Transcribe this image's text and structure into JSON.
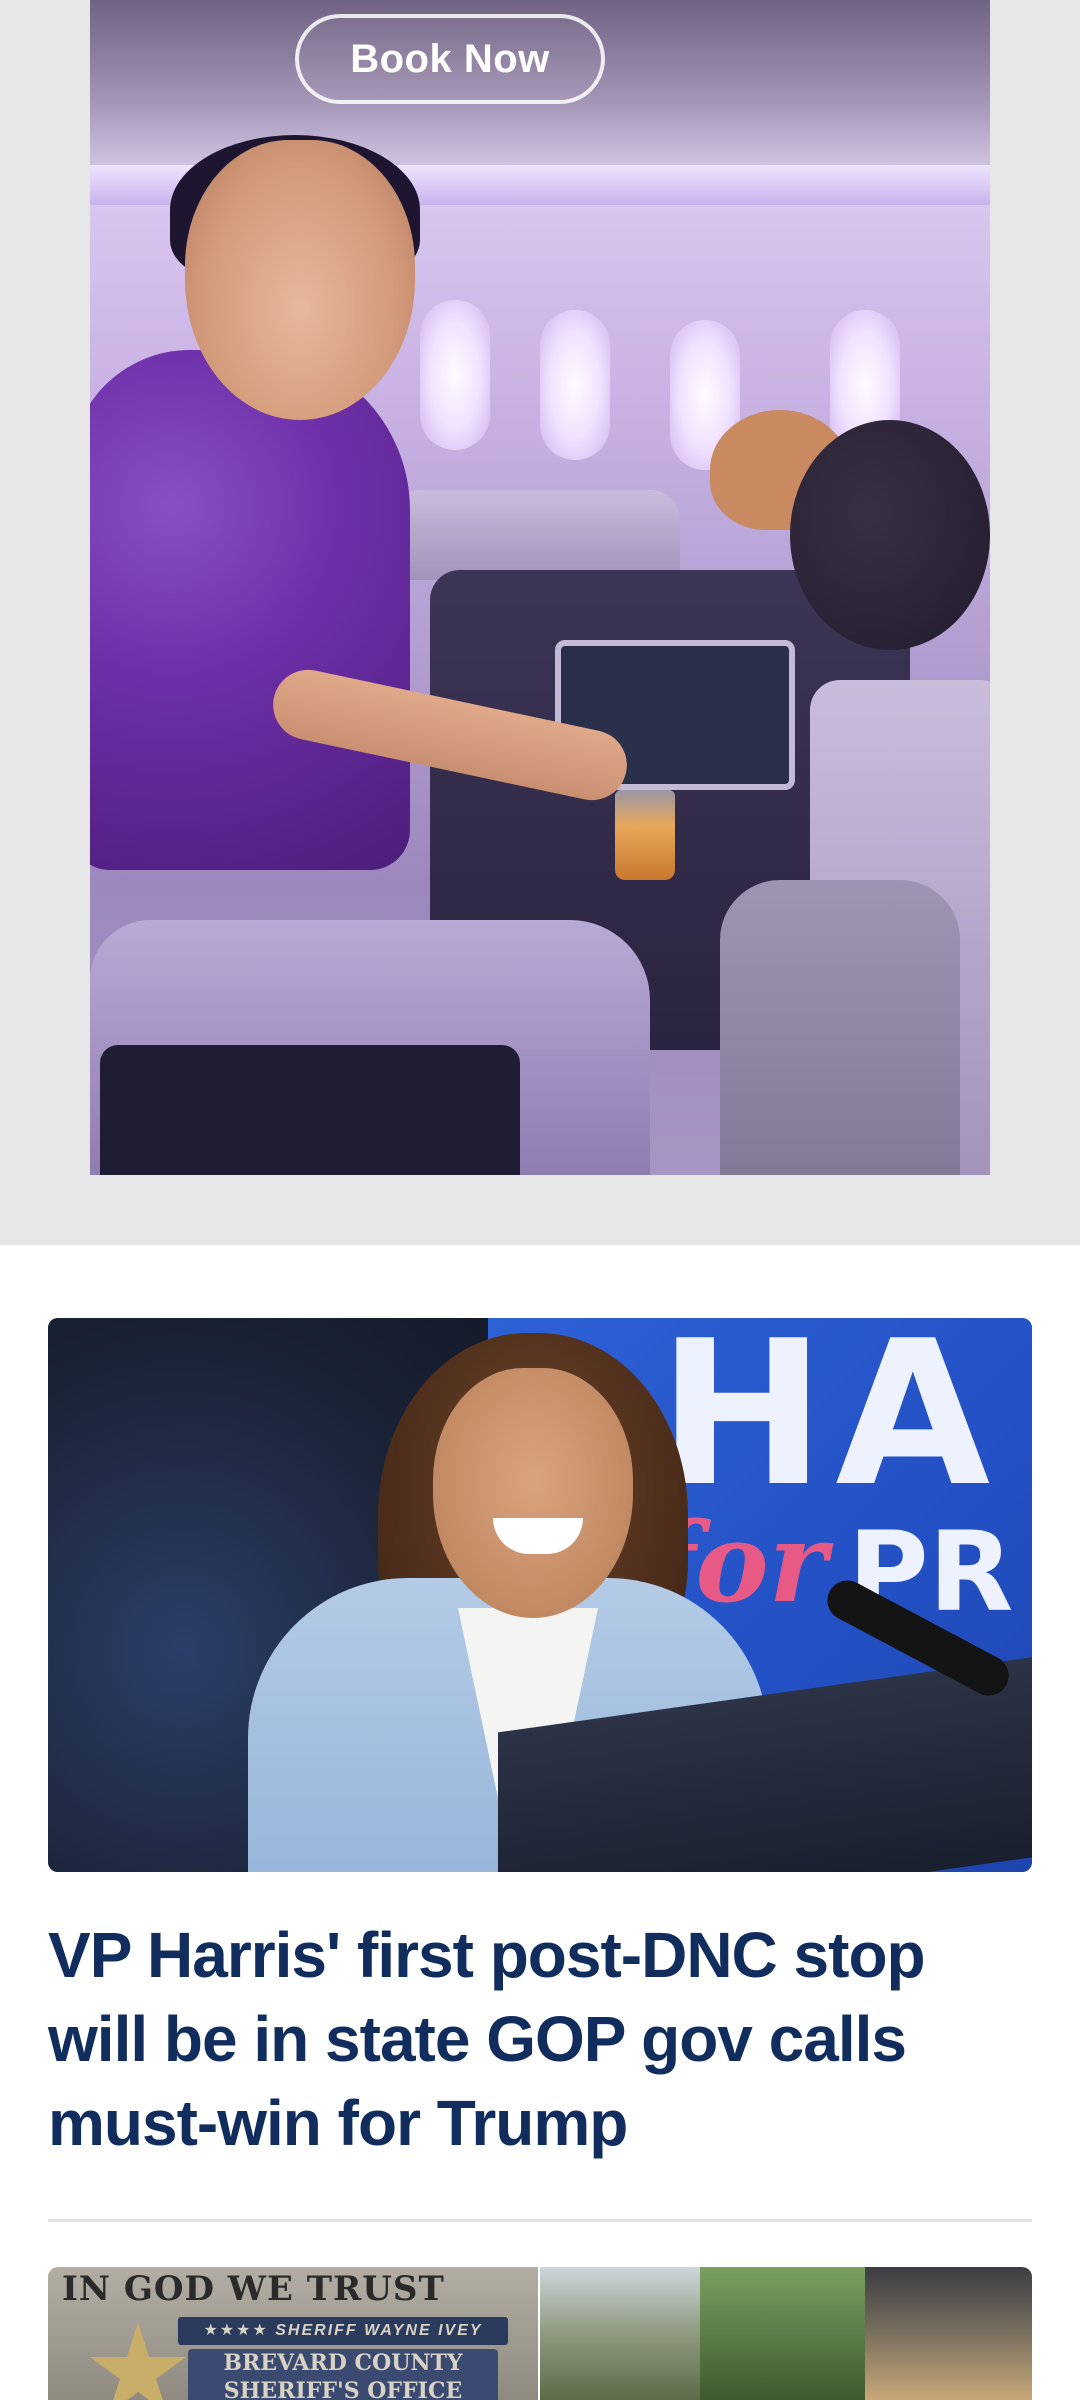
{
  "ad": {
    "cta_label": "Book Now",
    "image_alt": "flight-attendant-serving-drink-in-cabin"
  },
  "article": {
    "headline": "VP Harris' first post-DNC stop will be in state GOP gov calls must-win for Trump"
  },
  "next_article": {
    "thumb_motto": "IN GOD WE TRUST",
    "thumb_banner": "★★★★ SHERIFF WAYNE IVEY",
    "thumb_plaque": "BREVARD COUNTY SHERIFF'S OFFICE"
  },
  "colors": {
    "headline": "#112d5e",
    "ad_background": "#e6e6e6",
    "divider": "#e3e3e3"
  }
}
